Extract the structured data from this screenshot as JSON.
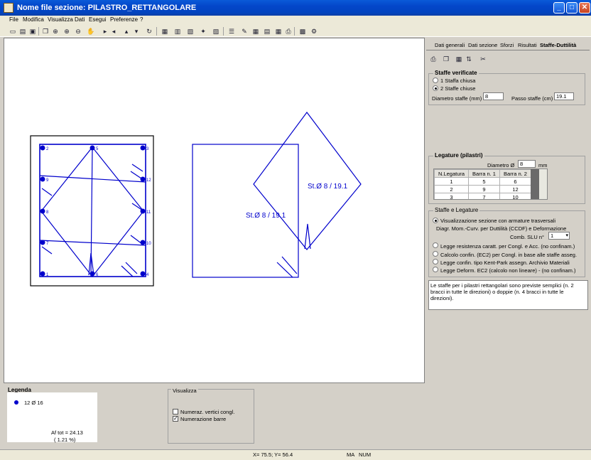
{
  "window": {
    "title": "Nome file sezione: PILASTRO_RETTANGOLARE"
  },
  "menu": [
    "File",
    "Modifica",
    "Visualizza",
    "Dati",
    "Esegui",
    "Preferenze",
    "?"
  ],
  "tabs": [
    "Dati generali",
    "Dati sezione",
    "Sforzi",
    "Risultati",
    "Staffe-Duttilità"
  ],
  "staffe": {
    "title": "Staffe verificate",
    "option1": "1 Staffa chiusa",
    "option2": "2 Staffe chiuse",
    "diam_label": "Diametro staffe (mm)",
    "diam_value": "8",
    "passo_label": "Passo staffe (cm)",
    "passo_value": "19.1"
  },
  "legature": {
    "title": "Legature (pilastri)",
    "diam_label": "Diametro  Ø",
    "diam_value": "8",
    "unit": "mm",
    "headers": [
      "N.Legatura",
      "Barra n. 1",
      "Barra n. 2"
    ],
    "rows": [
      [
        "1",
        "5",
        "6"
      ],
      [
        "2",
        "9",
        "12"
      ],
      [
        "3",
        "7",
        "10"
      ]
    ]
  },
  "staffe_leg": {
    "title": "Staffe e Legature",
    "opt_vis": "Visualizzazione sezione con armature trasversali",
    "diag_label": "Diagr. Mom.-Curv. per Duttilità (CCDF) e Deformazione",
    "comb_label": "Comb. SLU  n°",
    "comb_value": "1",
    "opt1": "Legge resistenza caratt. per Congl. e Acc. (no confinam.)",
    "opt2": "Calcolo confin. (EC2) per Congl. in base alle staffe asseg.",
    "opt3": "Legge confin. tipo Kent-Park  assegn. Archivio Materiali",
    "opt4": "Legge Deform.  EC2  (calcolo non lineare) - (no confinam.)"
  },
  "note": "Le staffe per i pilastri rettangolari sono previste semplici (n. 2 bracci in tutte le direzioni) o doppie (n. 4 bracci in tutte le direzioni).",
  "drawing": {
    "label1": "St.Ø 8 / 19.1",
    "label2": "St.Ø 8 / 19.1",
    "bar_numbers": [
      "2",
      "5",
      "3",
      "9",
      "12",
      "8",
      "11",
      "7",
      "10",
      "1",
      "6",
      "4"
    ]
  },
  "legenda": {
    "title": "Legenda",
    "item": "12 Ø 16",
    "af_tot": "Af tot = 24.13",
    "pct": "( 1.21 %)"
  },
  "visualizza": {
    "title": "Visualizza",
    "chk1": "Numeraz. vertici congl.",
    "chk2": "Numerazione barre"
  },
  "status": {
    "coords": "X=  75.5;  Y=  56.4",
    "ma": "MA",
    "num": "NUM"
  },
  "colors": {
    "drawing": "#0000cc",
    "titlebar": "#0a5ad8"
  }
}
